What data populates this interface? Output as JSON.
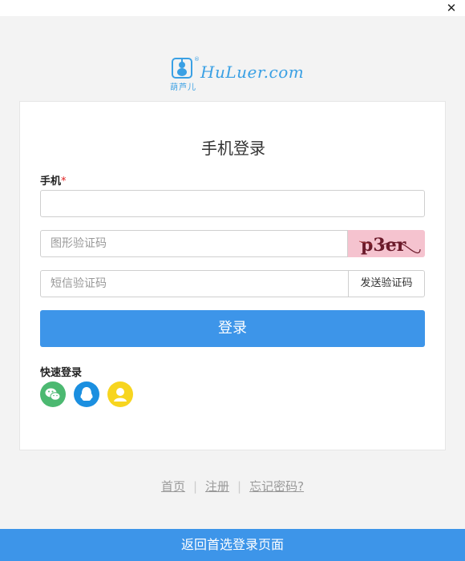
{
  "window": {
    "close_glyph": "✕"
  },
  "logo": {
    "cn_text": "葫芦儿",
    "en_text": "HuLuer.com",
    "reg_mark": "®"
  },
  "card": {
    "title": "手机登录",
    "phone_label": "手机",
    "required_mark": "*",
    "phone_placeholder": "",
    "captcha_placeholder": "图形验证码",
    "captcha_code": "p3er",
    "sms_placeholder": "短信验证码",
    "sms_button": "发送验证码",
    "login_button": "登录",
    "quick_login_label": "快速登录",
    "social_icons": [
      "wechat-icon",
      "qq-icon",
      "weibo-icon"
    ]
  },
  "links": {
    "home": "首页",
    "register": "注册",
    "forgot": "忘记密码?",
    "separator": "|"
  },
  "footer": {
    "back_button": "返回首选登录页面"
  },
  "colors": {
    "primary": "#3d95e9",
    "wechat": "#4cb971",
    "qq": "#1b8fe0",
    "weibo": "#f7d51f",
    "captcha_bg": "#f5c3cf",
    "required": "#e02020"
  }
}
